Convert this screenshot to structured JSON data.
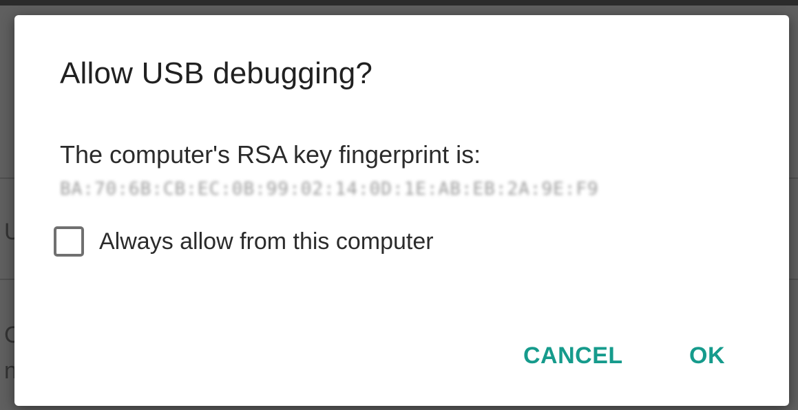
{
  "background": {
    "glyphs": [
      "U",
      "C",
      "n"
    ]
  },
  "dialog": {
    "title": "Allow USB debugging?",
    "message": "The computer's RSA key fingerprint is:",
    "fingerprint": "BA:70:6B:CB:EC:0B:99:02:14:0D:1E:AB:EB:2A:9E:F9",
    "checkbox": {
      "label": "Always allow from this computer",
      "checked": false
    },
    "buttons": {
      "cancel": "CANCEL",
      "ok": "OK"
    }
  },
  "colors": {
    "accent": "#169b8c",
    "scrim": "#5f5f5f",
    "surface": "#ffffff"
  }
}
